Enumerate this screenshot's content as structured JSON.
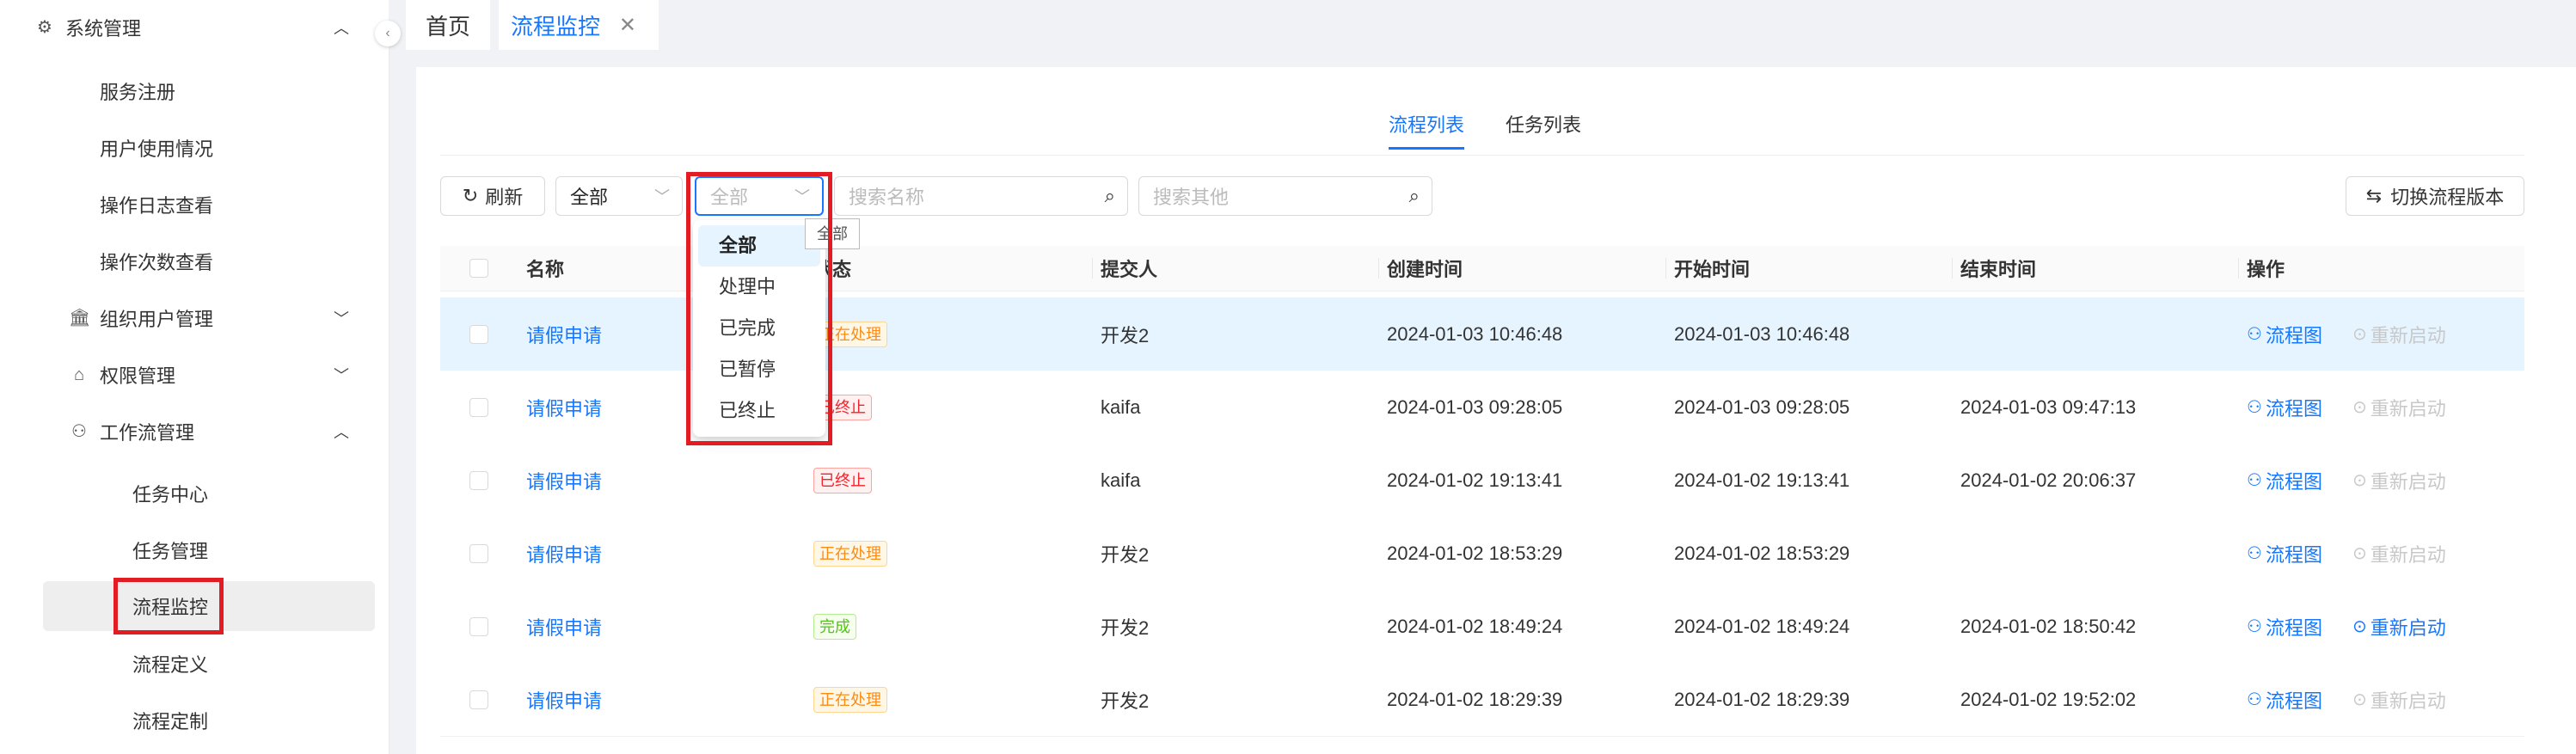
{
  "sidebar": {
    "items": [
      {
        "label": "系统管理",
        "icon": "gear-icon",
        "chevron": "up"
      },
      {
        "label": "服务注册"
      },
      {
        "label": "用户使用情况"
      },
      {
        "label": "操作日志查看"
      },
      {
        "label": "操作次数查看"
      },
      {
        "label": "组织用户管理",
        "icon": "bank-icon",
        "chevron": "down"
      },
      {
        "label": "权限管理",
        "icon": "key-icon",
        "chevron": "down"
      },
      {
        "label": "工作流管理",
        "icon": "workflow-icon",
        "chevron": "up"
      },
      {
        "label": "任务中心"
      },
      {
        "label": "任务管理"
      },
      {
        "label": "流程监控",
        "active": true
      },
      {
        "label": "流程定义"
      },
      {
        "label": "流程定制"
      }
    ]
  },
  "tabs": {
    "home": "首页",
    "current": "流程监控",
    "close": "✕"
  },
  "subtabs": [
    "流程列表",
    "任务列表"
  ],
  "toolbar": {
    "refresh": "刷新",
    "select1": "全部",
    "select2_placeholder": "全部",
    "search_name_placeholder": "搜索名称",
    "search_other_placeholder": "搜索其他",
    "switch_version": "切换流程版本"
  },
  "dropdown": {
    "options": [
      "全部",
      "处理中",
      "已完成",
      "已暂停",
      "已终止"
    ],
    "selected": "全部",
    "tooltip": "全部"
  },
  "table": {
    "columns": [
      "名称",
      "状态",
      "提交人",
      "创建时间",
      "开始时间",
      "结束时间",
      "操作"
    ],
    "rows": [
      {
        "name": "请假申请",
        "status": "正在处理",
        "status_color": "orange",
        "submitter": "开发2",
        "created": "2024-01-03 10:46:48",
        "started": "2024-01-03 10:46:48",
        "ended": "",
        "restart_enabled": false
      },
      {
        "name": "请假申请",
        "status": "已终止",
        "status_color": "red",
        "submitter": "kaifa",
        "created": "2024-01-03 09:28:05",
        "started": "2024-01-03 09:28:05",
        "ended": "2024-01-03 09:47:13",
        "restart_enabled": false
      },
      {
        "name": "请假申请",
        "status": "已终止",
        "status_color": "red",
        "submitter": "kaifa",
        "created": "2024-01-02 19:13:41",
        "started": "2024-01-02 19:13:41",
        "ended": "2024-01-02 20:06:37",
        "restart_enabled": false
      },
      {
        "name": "请假申请",
        "status": "正在处理",
        "status_color": "orange",
        "submitter": "开发2",
        "created": "2024-01-02 18:53:29",
        "started": "2024-01-02 18:53:29",
        "ended": "",
        "restart_enabled": false
      },
      {
        "name": "请假申请",
        "status": "完成",
        "status_color": "green",
        "submitter": "开发2",
        "created": "2024-01-02 18:49:24",
        "started": "2024-01-02 18:49:24",
        "ended": "2024-01-02 18:50:42",
        "restart_enabled": true
      },
      {
        "name": "请假申请",
        "status": "正在处理",
        "status_color": "orange",
        "submitter": "开发2",
        "created": "2024-01-02 18:29:39",
        "started": "2024-01-02 18:29:39",
        "ended": "2024-01-02 19:52:02",
        "restart_enabled": false
      }
    ],
    "action_flow": "流程图",
    "action_restart": "重新启动"
  },
  "colors": {
    "accent": "#1677ff",
    "highlight": "#e31b23"
  }
}
